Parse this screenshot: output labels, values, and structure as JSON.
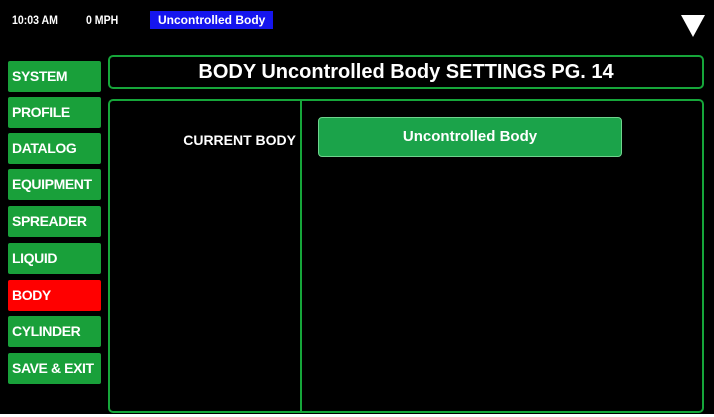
{
  "status_bar": {
    "time": "10:03 AM",
    "speed": "0 MPH",
    "body_badge": "Uncontrolled Body"
  },
  "menu_icon": "triangle-down-icon",
  "sidebar": {
    "items": [
      {
        "label": "SYSTEM",
        "active": false
      },
      {
        "label": "PROFILE",
        "active": false
      },
      {
        "label": "DATALOG",
        "active": false
      },
      {
        "label": "EQUIPMENT",
        "active": false
      },
      {
        "label": "SPREADER",
        "active": false
      },
      {
        "label": "LIQUID",
        "active": false
      },
      {
        "label": "BODY",
        "active": true
      },
      {
        "label": "CYLINDER",
        "active": false
      },
      {
        "label": "SAVE & EXIT",
        "active": false
      }
    ]
  },
  "main": {
    "title": "BODY Uncontrolled Body SETTINGS PG. 14",
    "current_body_label": "CURRENT BODY",
    "current_body_value": "Uncontrolled Body"
  },
  "colors": {
    "nav_green": "#19a03a",
    "nav_active_red": "#ff0000",
    "badge_blue": "#1515ee",
    "panel_border": "#16a63a",
    "background": "#000000"
  }
}
